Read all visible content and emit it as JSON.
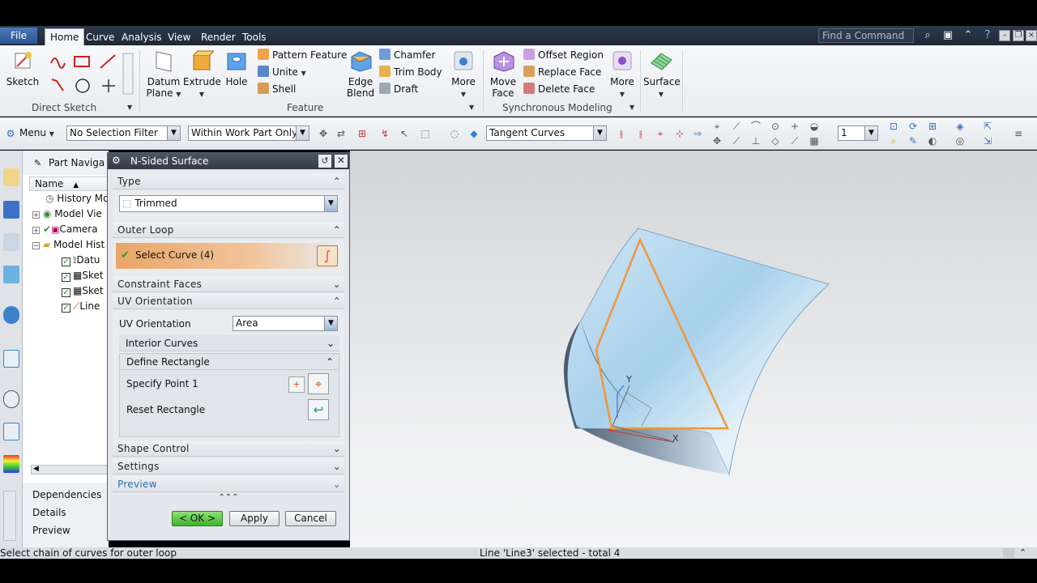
{
  "menubar": {
    "file": "File",
    "tabs": [
      {
        "label": "Home",
        "active": true
      },
      {
        "label": "Curve",
        "active": false
      },
      {
        "label": "Analysis",
        "active": false
      },
      {
        "label": "View",
        "active": false
      },
      {
        "label": "Render",
        "active": false
      },
      {
        "label": "Tools",
        "active": false
      }
    ],
    "search_placeholder": "Find a Command"
  },
  "ribbon": {
    "sketch": "Sketch",
    "direct_sketch_label": "Direct Sketch",
    "datum_plane_1": "Datum",
    "datum_plane_2": "Plane",
    "extrude": "Extrude",
    "hole": "Hole",
    "pattern_feature": "Pattern Feature",
    "unite": "Unite",
    "shell": "Shell",
    "edge_blend_1": "Edge",
    "edge_blend_2": "Blend",
    "chamfer": "Chamfer",
    "trim_body": "Trim Body",
    "draft": "Draft",
    "more_feature": "More",
    "feature_label": "Feature",
    "move_face_1": "Move",
    "move_face_2": "Face",
    "offset_region": "Offset Region",
    "replace_face": "Replace Face",
    "delete_face": "Delete Face",
    "more_sync": "More",
    "sync_label": "Synchronous Modeling",
    "surface": "Surface"
  },
  "toolbar": {
    "menu": "Menu",
    "selection_filter": "No Selection Filter",
    "scope": "Within Work Part Only",
    "curve_rule": "Tangent Curves",
    "layer": "1"
  },
  "navigator": {
    "title": "Part Naviga",
    "column": "Name",
    "rows": [
      {
        "label": "History Mo",
        "checked": false
      },
      {
        "label": "Model Vie",
        "checked": false
      },
      {
        "label": "Camera",
        "checked": true
      },
      {
        "label": "Model Hist",
        "checked": false
      },
      {
        "label": "Datu",
        "checked": true
      },
      {
        "label": "Sket",
        "checked": true
      },
      {
        "label": "Sket",
        "checked": true
      },
      {
        "label": "Line",
        "checked": true
      }
    ],
    "dependencies": "Dependencies",
    "details": "Details",
    "preview": "Preview"
  },
  "dialog": {
    "title": "N-Sided Surface",
    "type_header": "Type",
    "type_value": "Trimmed",
    "outer_loop_header": "Outer Loop",
    "select_curve": "Select Curve (4)",
    "constraint_faces_header": "Constraint Faces",
    "uv_orientation_header": "UV Orientation",
    "uv_orientation_label": "UV Orientation",
    "uv_orientation_value": "Area",
    "interior_curves": "Interior Curves",
    "define_rectangle": "Define Rectangle",
    "specify_point": "Specify Point 1",
    "reset_rectangle": "Reset Rectangle",
    "shape_control_header": "Shape Control",
    "settings_header": "Settings",
    "preview_header": "Preview",
    "ok": "< OK >",
    "apply": "Apply",
    "cancel": "Cancel"
  },
  "status": {
    "left": "Select chain of curves for outer loop",
    "center": "Line 'Line3' selected - total 4"
  },
  "triad": {
    "x": "X",
    "y": "Y"
  }
}
